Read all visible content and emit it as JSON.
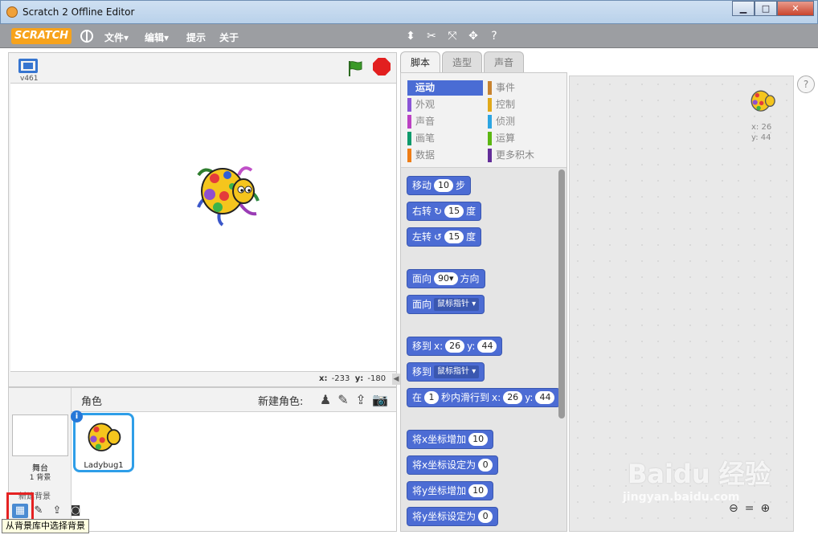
{
  "window": {
    "title": "Scratch 2 Offline Editor",
    "minimize": "▁",
    "maximize": "□",
    "close": "✕"
  },
  "menubar": {
    "logo": "SCRATCH",
    "menus": [
      "文件▾",
      "编辑▾",
      "提示",
      "关于"
    ]
  },
  "stage": {
    "version": "v461",
    "coords_x_label": "x:",
    "coords_x": "-233",
    "coords_y_label": "y:",
    "coords_y": "-180"
  },
  "sprite_pane": {
    "title": "角色",
    "new_sprite_label": "新建角色:",
    "stage_name": "舞台",
    "stage_backdrops": "1 背景",
    "new_backdrop_label": "新建背景",
    "sprite_name": "Ladybug1",
    "tooltip": "从背景库中选择背景"
  },
  "tabs": [
    "脚本",
    "造型",
    "声音"
  ],
  "categories": [
    {
      "label": "运动",
      "color": "#4a6cd4",
      "active": true
    },
    {
      "label": "事件",
      "color": "#c88330"
    },
    {
      "label": "外观",
      "color": "#8a55d7"
    },
    {
      "label": "控制",
      "color": "#e1a91a"
    },
    {
      "label": "声音",
      "color": "#bb42c3"
    },
    {
      "label": "侦测",
      "color": "#2ca5e2"
    },
    {
      "label": "画笔",
      "color": "#0e9a6c"
    },
    {
      "label": "运算",
      "color": "#5cb712"
    },
    {
      "label": "数据",
      "color": "#ee7d16"
    },
    {
      "label": "更多积木",
      "color": "#632d99"
    }
  ],
  "blocks": {
    "move": {
      "pre": "移动",
      "val": "10",
      "post": "步"
    },
    "turn_right": {
      "pre": "右转",
      "icon": "↻",
      "val": "15",
      "post": "度"
    },
    "turn_left": {
      "pre": "左转",
      "icon": "↺",
      "val": "15",
      "post": "度"
    },
    "point_dir": {
      "pre": "面向",
      "val": "90▾",
      "post": "方向"
    },
    "point_towards": {
      "pre": "面向",
      "dd": "鼠标指针 ▾"
    },
    "goto_xy": {
      "pre": "移到",
      "xl": "x:",
      "x": "26",
      "yl": "y:",
      "y": "44"
    },
    "goto": {
      "pre": "移到",
      "dd": "鼠标指针 ▾"
    },
    "glide": {
      "pre": "在",
      "secs": "1",
      "mid": "秒内滑行到",
      "xl": "x:",
      "x": "26",
      "yl": "y:",
      "y": "44"
    },
    "change_x": {
      "pre": "将x坐标增加",
      "val": "10"
    },
    "set_x": {
      "pre": "将x坐标设定为",
      "val": "0"
    },
    "change_y": {
      "pre": "将y坐标增加",
      "val": "10"
    },
    "set_y": {
      "pre": "将y坐标设定为",
      "val": "0"
    }
  },
  "scripts": {
    "x": "x: 26",
    "y": "y: 44"
  },
  "help": "?",
  "watermark": {
    "logo": "Baidu 经验",
    "url": "jingyan.baidu.com"
  }
}
